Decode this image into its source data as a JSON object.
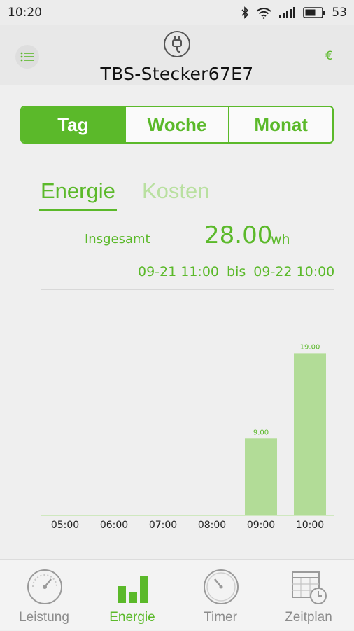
{
  "status_bar": {
    "time": "10:20",
    "battery": "53"
  },
  "header": {
    "device_name": "TBS-Stecker67E7",
    "currency_symbol": "€"
  },
  "period_tabs": [
    {
      "label": "Tag",
      "active": true
    },
    {
      "label": "Woche",
      "active": false
    },
    {
      "label": "Monat",
      "active": false
    }
  ],
  "mode_tabs": {
    "energy": "Energie",
    "costs": "Kosten",
    "active": "energy"
  },
  "summary": {
    "total_label": "Insgesamt",
    "total_value": "28.00",
    "unit": "wh",
    "range_start": "09-21 11:00",
    "range_sep": "bis",
    "range_end": "09-22 10:00"
  },
  "chart_data": {
    "type": "bar",
    "categories": [
      "05:00",
      "06:00",
      "07:00",
      "08:00",
      "09:00",
      "10:00"
    ],
    "values": [
      0,
      0,
      0,
      0,
      9.0,
      19.0
    ],
    "data_labels": [
      "",
      "",
      "",
      "",
      "9.00",
      "19.00"
    ],
    "ylim": [
      0,
      21
    ],
    "bar_color": "#b2dc97",
    "grid": false,
    "title": "",
    "xlabel": "",
    "ylabel": ""
  },
  "bottom_nav": [
    {
      "label": "Leistung",
      "icon": "gauge-icon",
      "active": false
    },
    {
      "label": "Energie",
      "icon": "bar-chart-icon",
      "active": true
    },
    {
      "label": "Timer",
      "icon": "timer-icon",
      "active": false
    },
    {
      "label": "Zeitplan",
      "icon": "calendar-clock-icon",
      "active": false
    }
  ],
  "colors": {
    "accent": "#5bb92a",
    "accent_light": "#b9e0a0",
    "inactive": "#8c8c8c"
  }
}
